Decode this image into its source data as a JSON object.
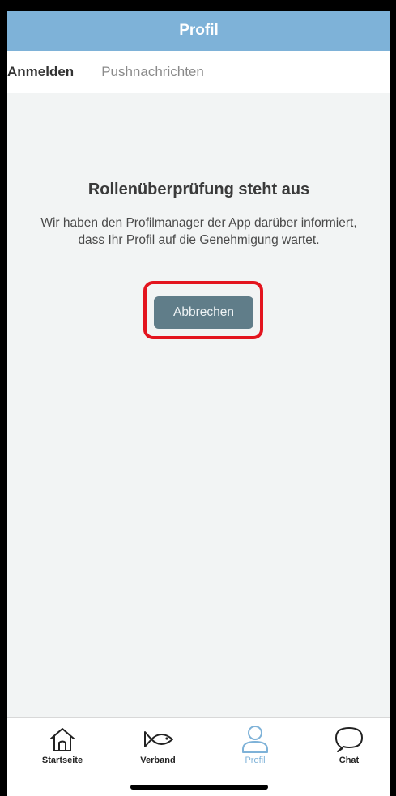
{
  "header": {
    "title": "Profil"
  },
  "tabs": [
    {
      "label": "Anmelden"
    },
    {
      "label": "Pushnachrichten"
    }
  ],
  "main": {
    "title": "Rollenüberprüfung steht aus",
    "description": "Wir haben den Profilmanager der App darüber informiert, dass Ihr Profil auf die Genehmigung wartet.",
    "cancel_label": "Abbrechen"
  },
  "tabbar": {
    "items": [
      {
        "label": "Startseite",
        "icon": "home-icon"
      },
      {
        "label": "Verband",
        "icon": "fish-icon"
      },
      {
        "label": "Profil",
        "icon": "person-icon"
      },
      {
        "label": "Chat",
        "icon": "chat-bubble-icon"
      }
    ]
  },
  "colors": {
    "header": "#7eb2d8",
    "button": "#607d89",
    "highlight": "#e3141e",
    "active_tab": "#7eb2d8"
  }
}
